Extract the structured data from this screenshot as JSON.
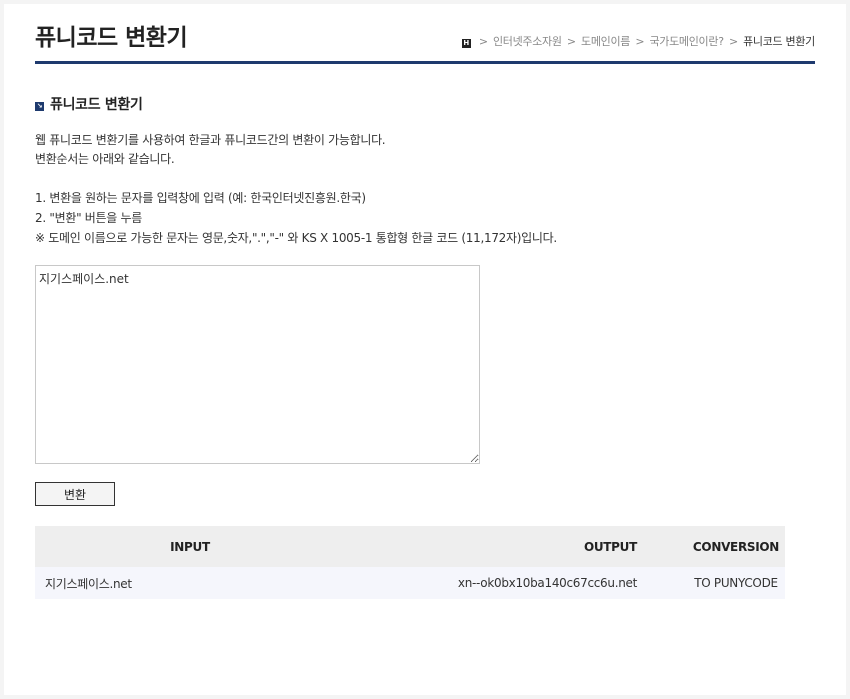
{
  "header": {
    "title": "퓨니코드 변환기",
    "breadcrumb": {
      "home_glyph": "H",
      "items": [
        "인터넷주소자원",
        "도메인이름",
        "국가도메인이란?"
      ],
      "current": "퓨니코드 변환기",
      "separator": ">"
    }
  },
  "section": {
    "title": "퓨니코드 변환기",
    "lines": [
      "웹 퓨니코드 변환기를 사용하여 한글과 퓨니코드간의 변환이 가능합니다.",
      "변환순서는 아래와 같습니다.",
      "1. 변환을 원하는 문자를 입력창에 입력 (예: 한국인터넷진흥원.한국)",
      "2. \"변환\" 버튼을 누름",
      "※ 도메인 이름으로 가능한 문자는 영문,숫자,\".\",\"-\" 와 KS X 1005-1 통합형 한글 코드 (11,172자)입니다."
    ]
  },
  "input": {
    "value": "지기스페이스.net"
  },
  "convert_button": {
    "label": "변환"
  },
  "results": {
    "headers": [
      "INPUT",
      "OUTPUT",
      "CONVERSION"
    ],
    "rows": [
      [
        "지기스페이스.net",
        "xn--ok0bx10ba140c67cc6u.net",
        "TO PUNYCODE"
      ]
    ]
  },
  "colors": {
    "accent": "#1e3a6e",
    "table_header_bg": "#eeeeee",
    "table_row_bg": "#f5f6fc"
  }
}
